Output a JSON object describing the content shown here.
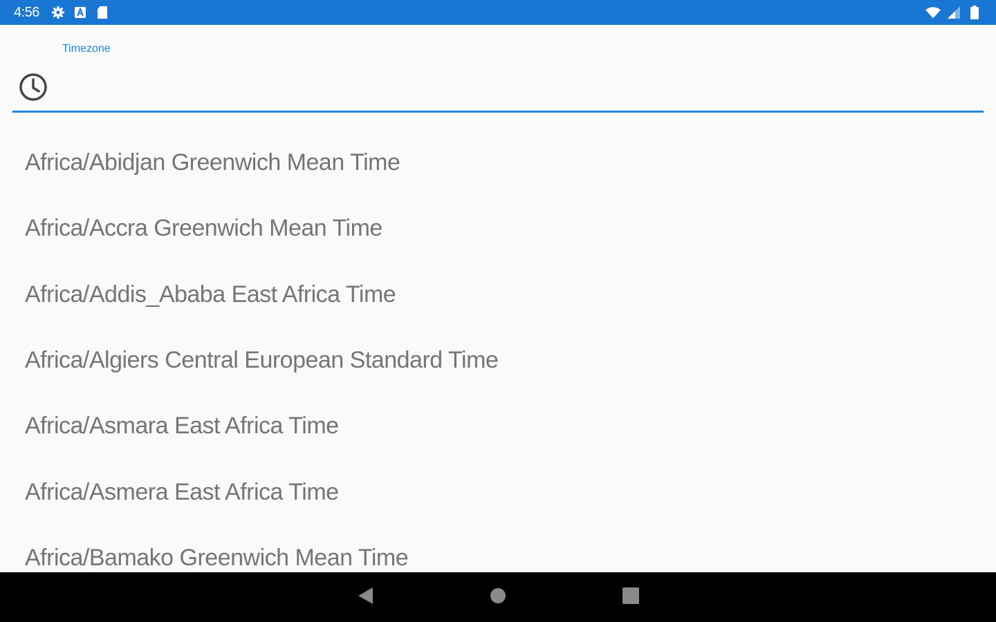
{
  "status_bar": {
    "time": "4:56",
    "left_icons": [
      "gear-icon",
      "a-box-icon",
      "sd-card-icon"
    ],
    "right_icons": [
      "wifi-icon",
      "signal-icon",
      "battery-icon"
    ],
    "background": "#1976d2"
  },
  "timezone_field": {
    "label": "Timezone",
    "value": "",
    "icon": "clock-icon",
    "accent": "#1e88e5"
  },
  "timezones": [
    "Africa/Abidjan Greenwich Mean Time",
    "Africa/Accra Greenwich Mean Time",
    "Africa/Addis_Ababa East Africa Time",
    "Africa/Algiers Central European Standard Time",
    "Africa/Asmara East Africa Time",
    "Africa/Asmera East Africa Time",
    "Africa/Bamako Greenwich Mean Time"
  ],
  "nav_bar": {
    "buttons": [
      "back-icon",
      "home-icon",
      "recents-icon"
    ]
  }
}
